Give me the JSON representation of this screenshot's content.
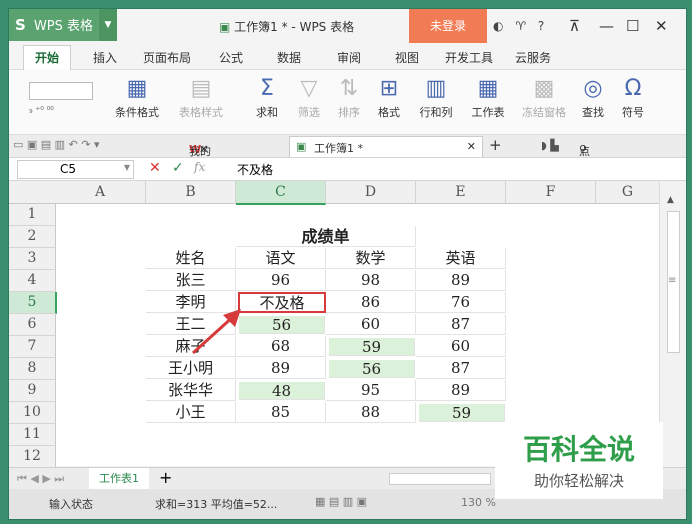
{
  "app": {
    "name": "WPS 表格",
    "doc_title": "工作簿1 * - WPS 表格",
    "login": "未登录",
    "help": "?"
  },
  "menu": [
    "开始",
    "插入",
    "页面布局",
    "公式",
    "数据",
    "审阅",
    "视图",
    "开发工具",
    "云服务"
  ],
  "ribbon": {
    "cond_format": "条件格式",
    "table_style": "表格样式",
    "sum": "求和",
    "filter": "筛选",
    "sort": "排序",
    "format": "格式",
    "rowcol": "行和列",
    "worksheet": "工作表",
    "freeze": "冻结窗格",
    "find": "查找",
    "symbol": "符号"
  },
  "tabs": {
    "mywps": "我的WPS",
    "doc": "工作簿1 *",
    "search": "点此查找命令"
  },
  "formula_bar": {
    "cell_ref": "C5",
    "fx": "fx",
    "value": "不及格"
  },
  "columns": [
    "A",
    "B",
    "C",
    "D",
    "E",
    "F",
    "G"
  ],
  "rows": [
    "1",
    "2",
    "3",
    "4",
    "5",
    "6",
    "7",
    "8",
    "9",
    "10",
    "11",
    "12"
  ],
  "table": {
    "title": "成绩单",
    "headers": [
      "姓名",
      "语文",
      "数学",
      "英语"
    ],
    "data": [
      [
        "张三",
        "96",
        "98",
        "89"
      ],
      [
        "李明",
        "不及格",
        "86",
        "76"
      ],
      [
        "王二",
        "56",
        "60",
        "87"
      ],
      [
        "麻子",
        "68",
        "59",
        "60"
      ],
      [
        "王小明",
        "89",
        "56",
        "87"
      ],
      [
        "张华华",
        "48",
        "95",
        "89"
      ],
      [
        "小王",
        "85",
        "88",
        "59"
      ]
    ]
  },
  "sheet": {
    "name": "工作表1",
    "add": "+"
  },
  "status": {
    "mode": "输入状态",
    "summary": "求和=313 平均值=52...",
    "zoom": "130 %"
  },
  "watermark": {
    "title": "百科全说",
    "subtitle": "助你轻松解决"
  },
  "colors": {
    "accent": "#2b8a4f",
    "login": "#f07b54",
    "low_score_fill": "#dcf1d9",
    "active_border": "#d63a3a",
    "arrow": "#d63a3a"
  }
}
